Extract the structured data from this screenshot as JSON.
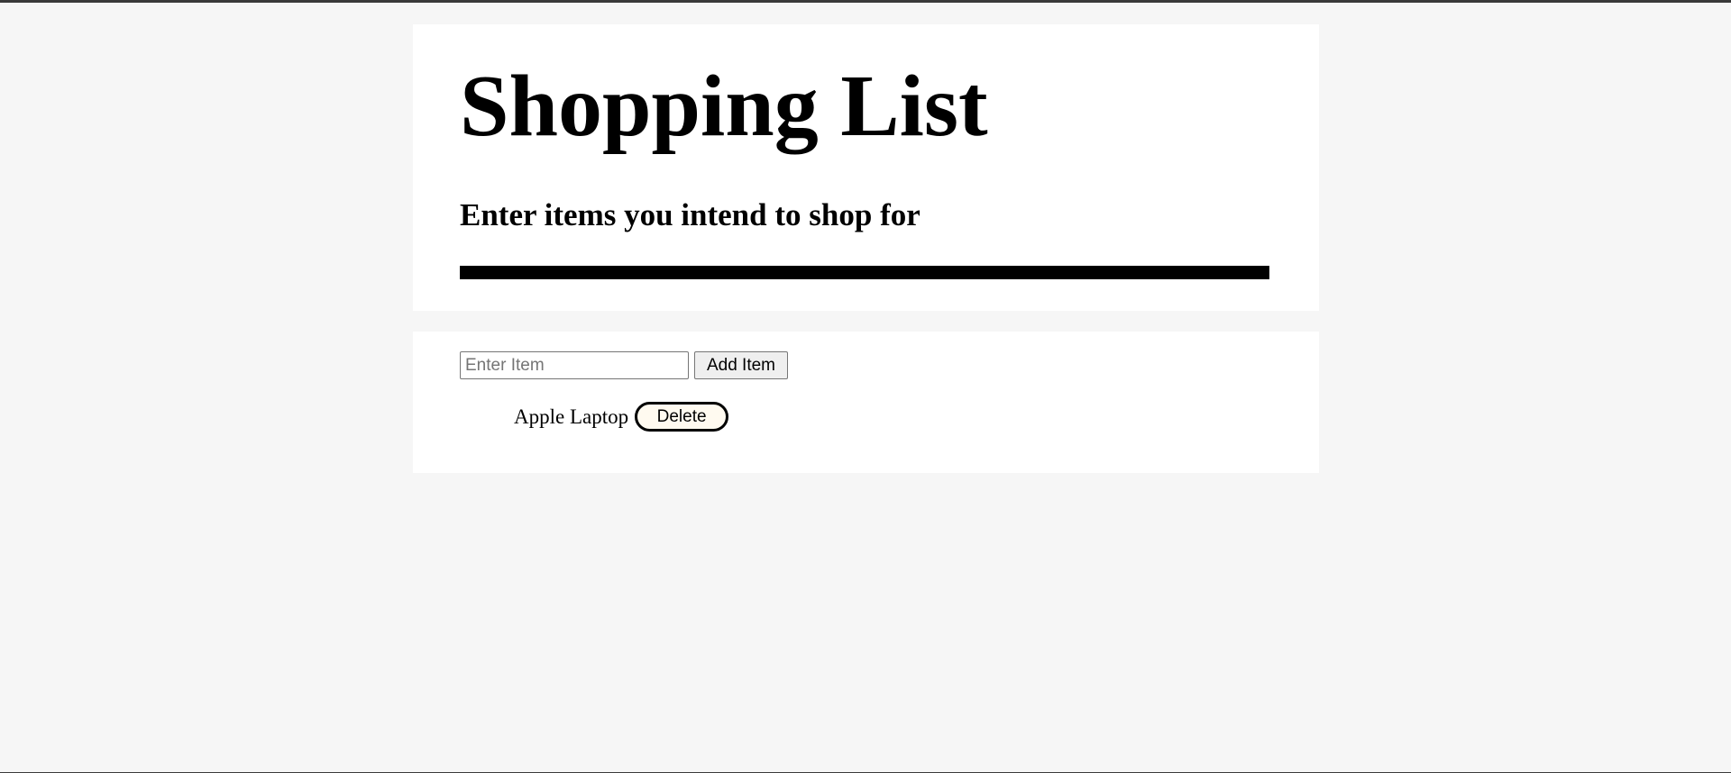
{
  "header": {
    "title": "Shopping List",
    "subtitle": "Enter items you intend to shop for"
  },
  "form": {
    "input_value": "",
    "input_placeholder": "Enter Item",
    "add_button_label": "Add Item"
  },
  "list": {
    "items": [
      {
        "label": "Apple Laptop",
        "delete_label": "Delete"
      }
    ]
  },
  "colors": {
    "page_background": "#f6f6f6",
    "card_background": "#ffffff",
    "divider": "#000000",
    "delete_button_fill": "#fffaf0"
  }
}
